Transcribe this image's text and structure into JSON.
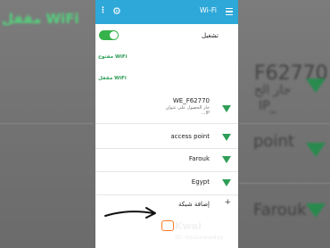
{
  "background": {
    "left_label": "مقفل WiFi",
    "right_top": "F62770",
    "right_sub": "جار الح",
    "right_sub2": "IP_",
    "right_point": "point",
    "right_farouk": "Farouk"
  },
  "header": {
    "title": "Wi-Fi",
    "menu_icon": "menu-icon",
    "settings_icon": "gear-icon",
    "more_icon": "more-vertical-icon"
  },
  "toggle": {
    "label": "تشغيل",
    "state": "on"
  },
  "sections": {
    "open": "مفتوح WiFi",
    "locked": "مقفل WiFi"
  },
  "networks": [
    {
      "name": "WE_F62770",
      "status": "جار الحصول على عنوان",
      "status2": "...IP"
    },
    {
      "name": "access point"
    },
    {
      "name": "Farouk"
    },
    {
      "name": "Egypt"
    }
  ],
  "add_network": {
    "label": "إضافة شبكة",
    "icon": "plus-icon"
  },
  "watermark": {
    "brand": "Kwai",
    "id": "ID: mozurwwdxy"
  },
  "colors": {
    "header": "#2ea8d8",
    "accent": "#2f9e57",
    "toggle": "#35b24a"
  }
}
